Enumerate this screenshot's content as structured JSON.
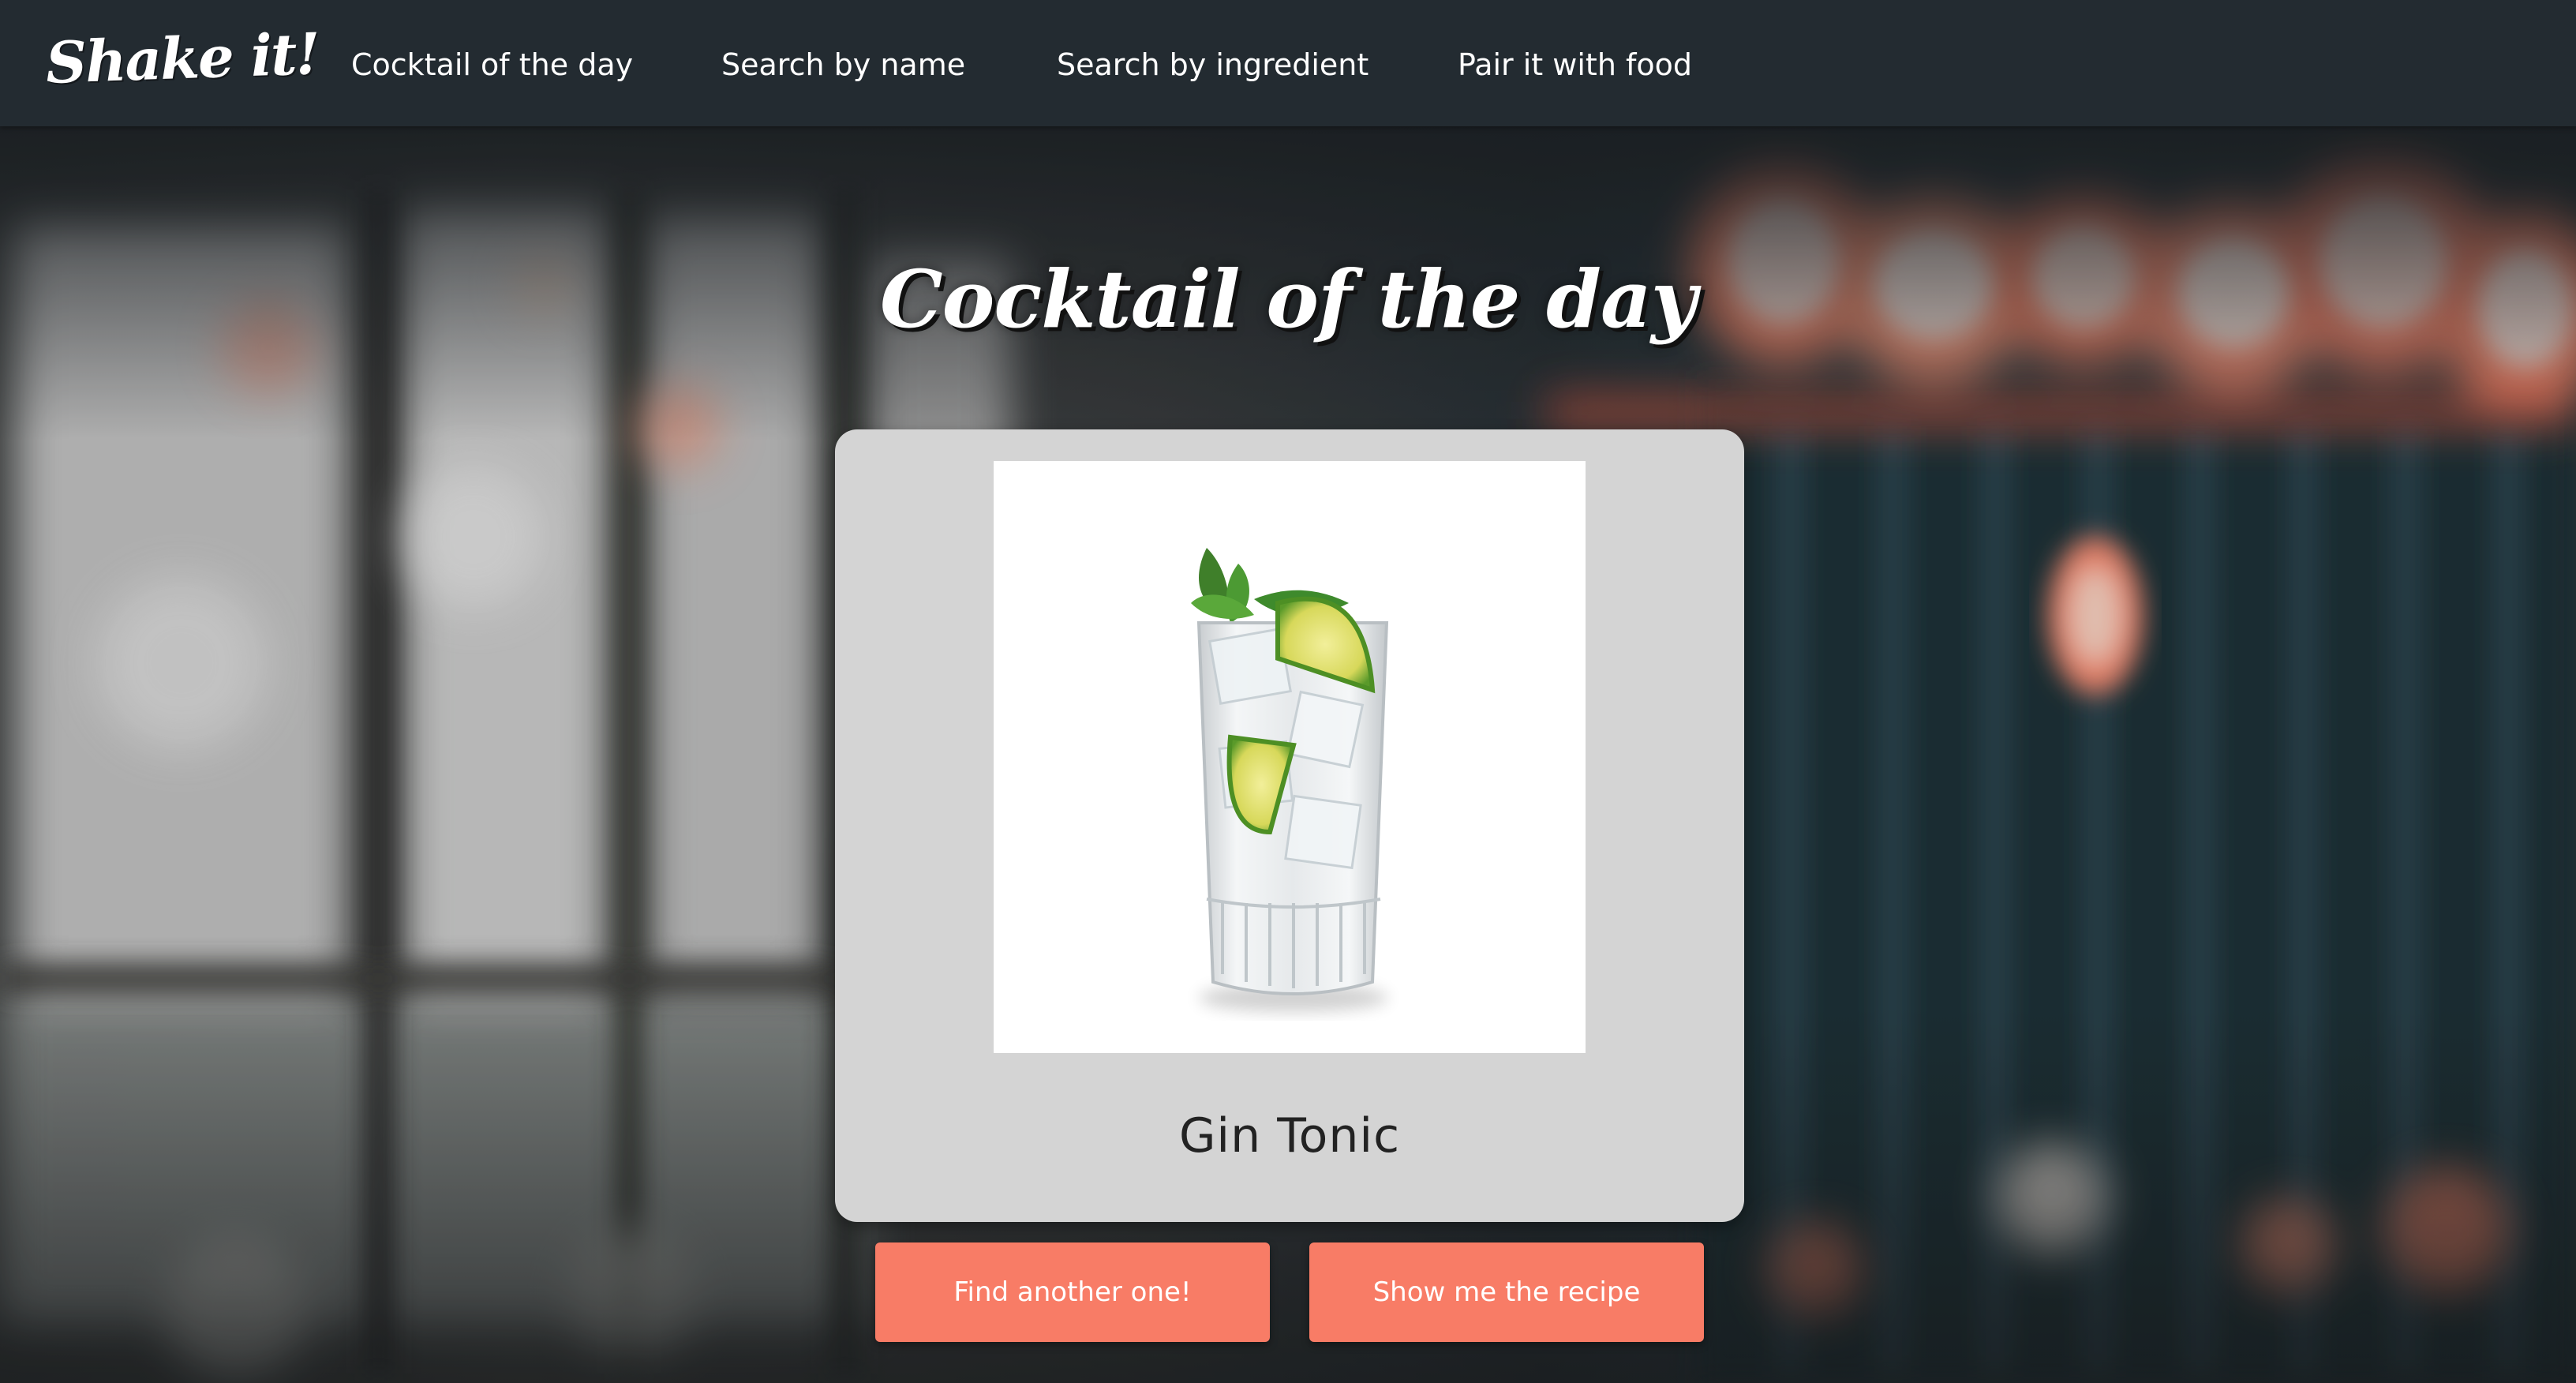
{
  "navbar": {
    "brand": "Shake it!",
    "links": [
      {
        "label": "Cocktail of the day"
      },
      {
        "label": "Search by name"
      },
      {
        "label": "Search by ingredient"
      },
      {
        "label": "Pair it with food"
      }
    ]
  },
  "hero": {
    "title": "Cocktail of the day"
  },
  "card": {
    "drink_name": "Gin Tonic",
    "image_icon": "gin-tonic-glass-photo"
  },
  "actions": {
    "find_another": "Find another one!",
    "show_recipe": "Show me the recipe"
  },
  "colors": {
    "navbar_bg": "#232b31",
    "card_bg": "#d4d4d4",
    "button_bg": "#f87c66",
    "text_light": "#ffffff"
  }
}
